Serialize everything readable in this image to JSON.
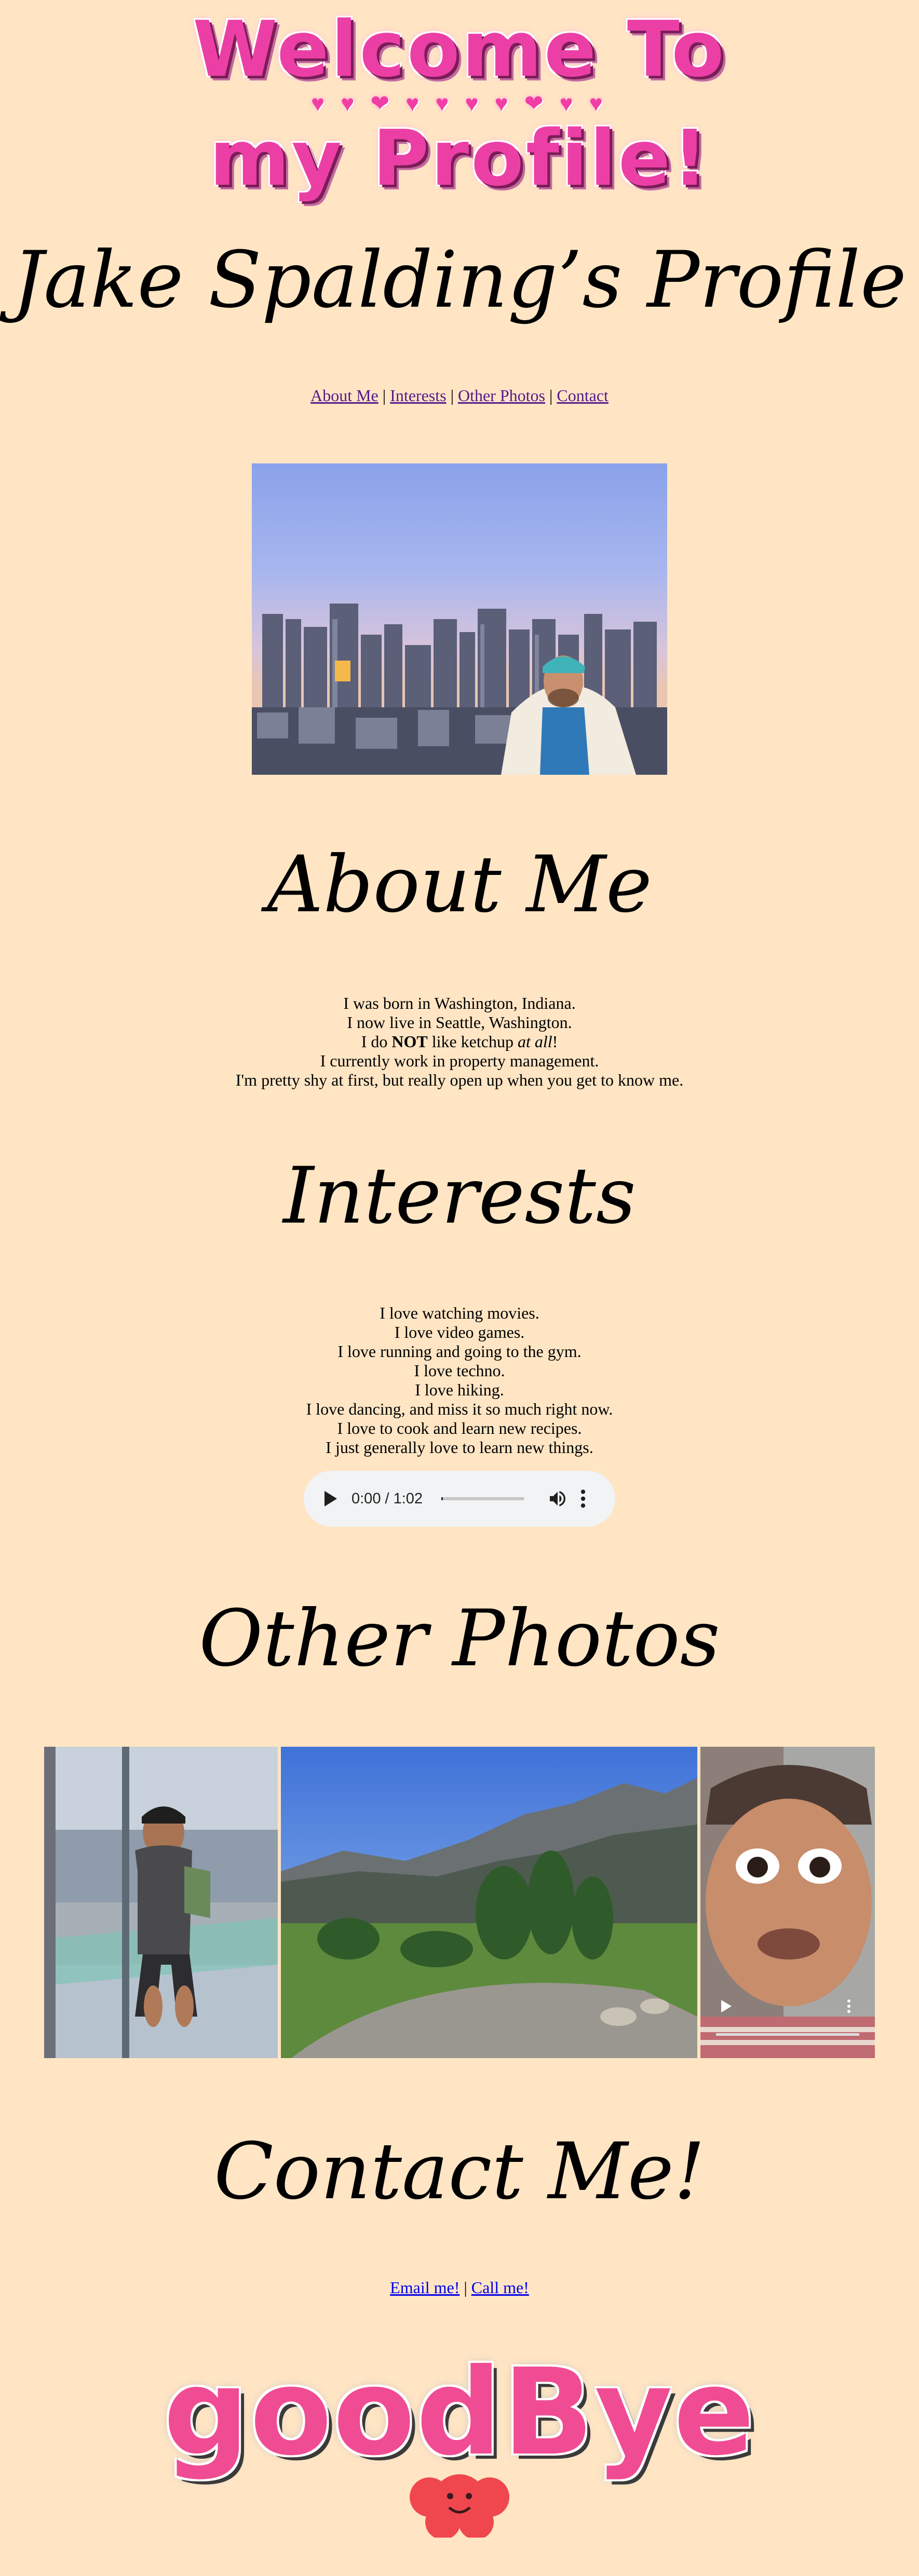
{
  "banner": {
    "line1": "Welcome To",
    "hearts": "♥ ♥ ❤ ♥ ♥ ♥ ♥ ❤ ♥ ♥",
    "line2": "my Profile!"
  },
  "page_title": "Jake Spalding’s Profile",
  "nav": {
    "about": "About Me",
    "interests": "Interests",
    "photos": "Other Photos",
    "contact": "Contact",
    "separator": " | "
  },
  "about": {
    "heading": "About Me",
    "line1": "I was born in Washington, Indiana.",
    "line2": "I now live in Seattle, Washington.",
    "line3_pre": "I do ",
    "line3_bold": "NOT",
    "line3_mid": " like ketchup ",
    "line3_italic": "at all",
    "line3_post": "!",
    "line4": "I currently work in property management.",
    "line5": "I'm pretty shy at first, but really open up when you get to know me."
  },
  "interests": {
    "heading": "Interests",
    "items": [
      "I love watching movies.",
      "I love video games.",
      "I love running and going to the gym.",
      "I love techno.",
      "I love hiking.",
      "I love dancing, and miss it so much right now.",
      "I love to cook and learn new recipes.",
      "I just generally love to learn new things."
    ]
  },
  "audio": {
    "time": "0:00 / 1:02",
    "progress": 0.02
  },
  "photos": {
    "heading": "Other Photos"
  },
  "contact": {
    "heading": "Contact Me!",
    "email": "Email me!",
    "call": "Call me!",
    "separator": " | "
  },
  "goodbye": {
    "text": "goodBye"
  },
  "colors": {
    "background": "#ffe5c4",
    "visited_link": "#551a8b",
    "link": "#0000ee",
    "glitter_pink": "#ec3fa6"
  }
}
